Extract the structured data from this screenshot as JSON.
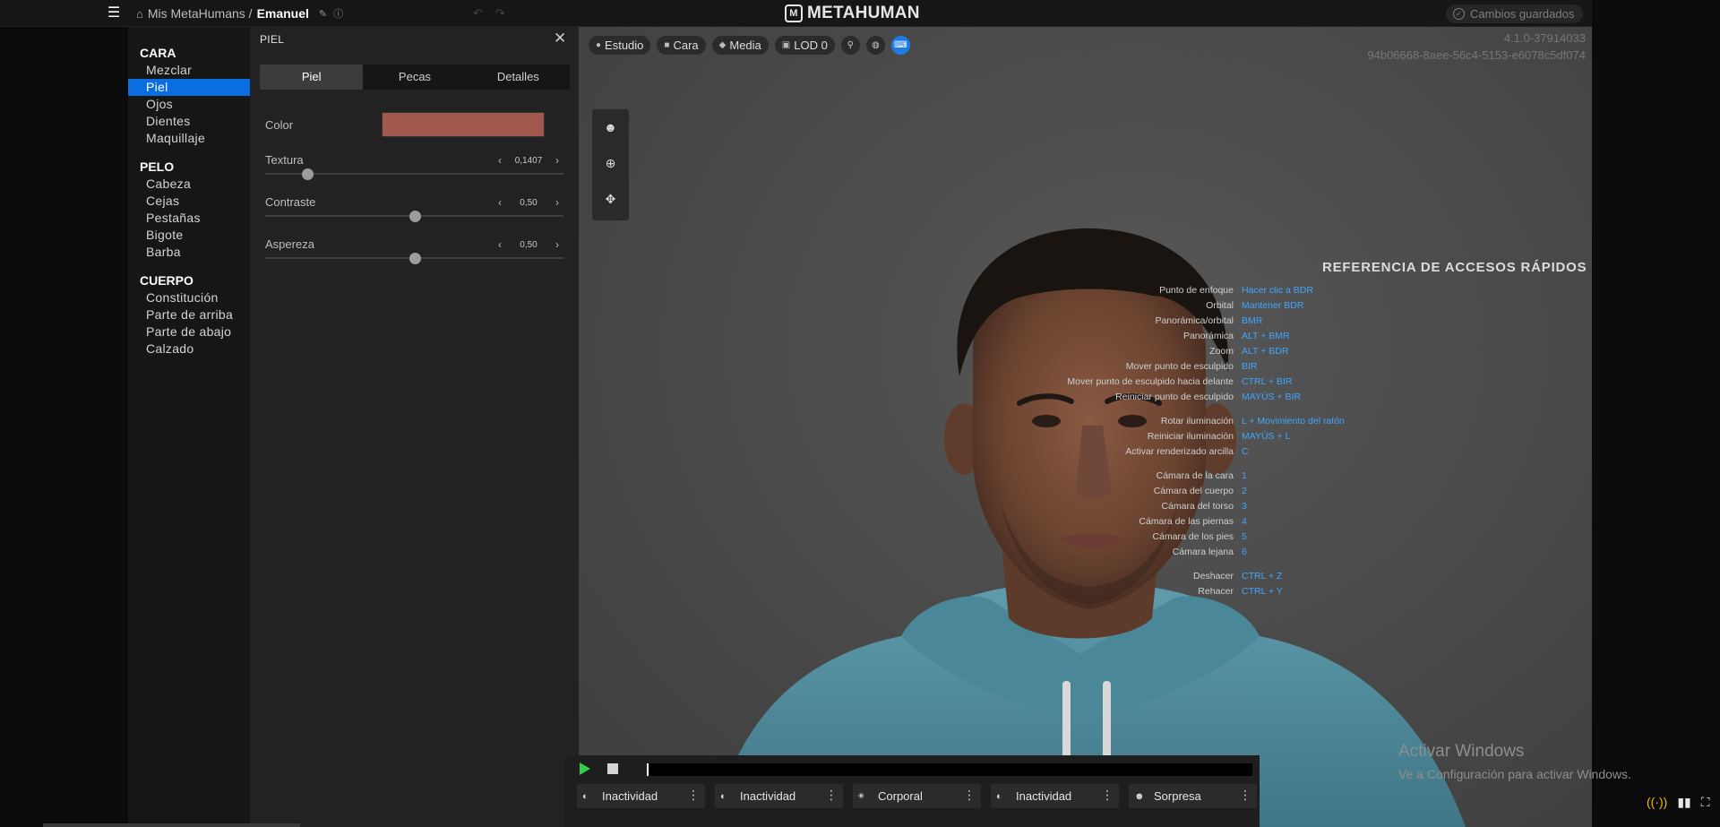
{
  "topbar": {
    "breadcrumb_root": "Mis MetaHumans /",
    "character_name": "Emanuel",
    "logo_text": "METAHUMAN",
    "saved_status": "Cambios guardados"
  },
  "nav": {
    "sections": [
      {
        "title": "CARA",
        "items": [
          "Mezclar",
          "Piel",
          "Ojos",
          "Dientes",
          "Maquillaje"
        ]
      },
      {
        "title": "PELO",
        "items": [
          "Cabeza",
          "Cejas",
          "Pestañas",
          "Bigote",
          "Barba"
        ]
      },
      {
        "title": "CUERPO",
        "items": [
          "Constitución",
          "Parte de arriba",
          "Parte de abajo",
          "Calzado"
        ]
      }
    ],
    "active_item": "Piel"
  },
  "panel": {
    "title": "PIEL",
    "tabs": [
      "Piel",
      "Pecas",
      "Detalles"
    ],
    "active_tab": "Piel",
    "color_label": "Color",
    "color_value": "#a0584c",
    "sliders": [
      {
        "label": "Textura",
        "value_text": "0,1407",
        "value": 0.1407
      },
      {
        "label": "Contraste",
        "value_text": "0,50",
        "value": 0.5
      },
      {
        "label": "Aspereza",
        "value_text": "0,50",
        "value": 0.5
      }
    ]
  },
  "viewport": {
    "toolbar": [
      "Estudio",
      "Cara",
      "Media",
      "LOD 0"
    ],
    "version": "4.1.0-37914033",
    "build_id": "94b06668-8aee-56c4-5153-e6078c5df074"
  },
  "shortcuts": {
    "title": "REFERENCIA DE ACCESOS RÁPIDOS",
    "rows": [
      {
        "action": "Punto de enfoque",
        "keys": "Hacer clic a BDR"
      },
      {
        "action": "Orbital",
        "keys": "Mantener BDR"
      },
      {
        "action": "Panorámica/orbital",
        "keys": "BMR"
      },
      {
        "action": "Panorámica",
        "keys": "ALT + BMR"
      },
      {
        "action": "Zoom",
        "keys": "ALT + BDR"
      },
      {
        "action": "Mover punto de esculpido",
        "keys": "BIR"
      },
      {
        "action": "Mover punto de esculpido hacia delante",
        "keys": "CTRL + BIR"
      },
      {
        "action": "Reiniciar punto de esculpido",
        "keys": "MAYÚS + BIR"
      },
      {
        "action": "Rotar iluminación",
        "keys": "L + Movimiento del ratón"
      },
      {
        "action": "Reiniciar iluminación",
        "keys": "MAYÚS + L"
      },
      {
        "action": "Activar renderizado arcilla",
        "keys": "C"
      },
      {
        "action": "Cámara de la cara",
        "keys": "1"
      },
      {
        "action": "Cámara del cuerpo",
        "keys": "2"
      },
      {
        "action": "Cámara del torso",
        "keys": "3"
      },
      {
        "action": "Cámara de las piernas",
        "keys": "4"
      },
      {
        "action": "Cámara de los pies",
        "keys": "5"
      },
      {
        "action": "Cámara lejana",
        "keys": "6"
      },
      {
        "action": "Deshacer",
        "keys": "CTRL + Z"
      },
      {
        "action": "Rehacer",
        "keys": "CTRL + Y"
      }
    ]
  },
  "timeline": {
    "slots": [
      "Inactividad",
      "Inactividad",
      "Corporal",
      "Inactividad",
      "Sorpresa"
    ]
  },
  "windows": {
    "activate_title": "Activar Windows",
    "activate_sub": "Ve a Configuración para activar Windows."
  }
}
